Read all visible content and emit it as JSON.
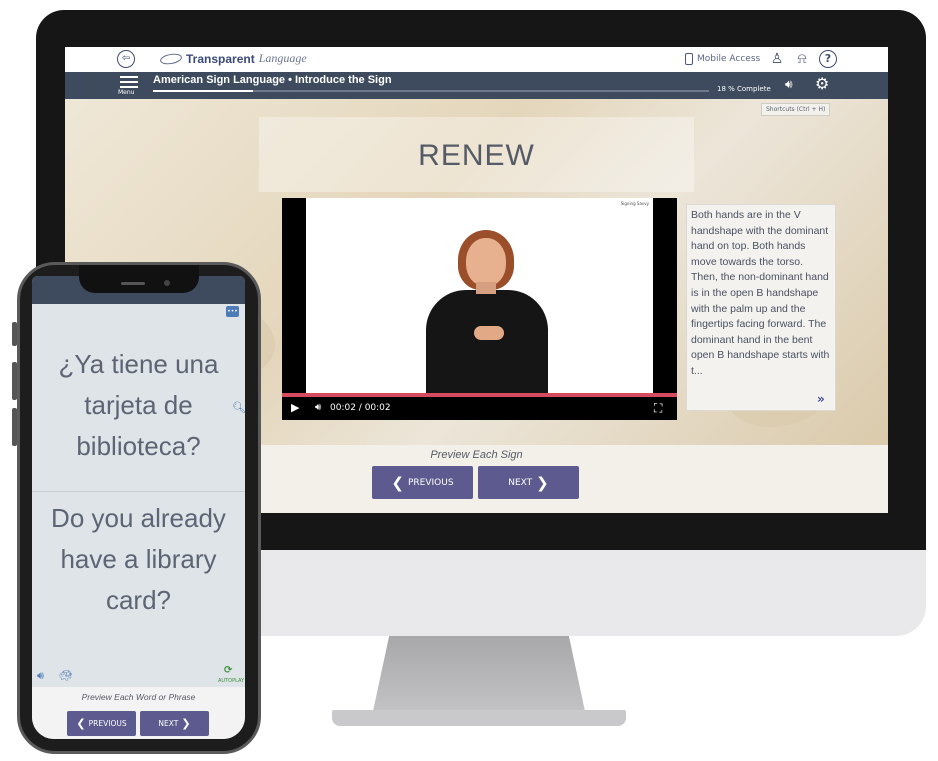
{
  "app": {
    "logo_strong": "Transparent",
    "logo_italic": "Language",
    "mobile_access": "Mobile Access",
    "menu_label": "Menu",
    "lesson_title": "American Sign Language • Introduce the Sign",
    "progress_percent": 18,
    "progress_text": "18 % Complete",
    "shortcuts": "Shortcuts (Ctrl + H)"
  },
  "lesson": {
    "word": "RENEW",
    "video_time": "00:02 / 00:02",
    "watermark": "Signing Savvy",
    "description": "Both hands are in the V handshape with the dominant hand on top. Both hands move towards the torso. Then, the non-dominant hand is in the open B handshape with the palm up and the fingertips facing forward. The dominant hand in the bent open B handshape starts with t...",
    "preview_label": "Preview Each Sign",
    "prev_label": "PREVIOUS",
    "next_label": "NEXT"
  },
  "phone": {
    "spanish_phrase": "¿Ya tiene una tarjeta de biblioteca?",
    "english_phrase": "Do you already have a library card?",
    "autoplay_label": "AUTOPLAY",
    "preview_label": "Preview Each Word or Phrase",
    "prev_label": "PREVIOUS",
    "next_label": "NEXT"
  },
  "icons": {
    "back": "back-arrow-icon",
    "mobile": "mobile-phone-icon",
    "user": "user-icon",
    "notifications": "bell-icon",
    "help": "help-icon",
    "settings": "gear-icon",
    "audio": "speaker-icon"
  },
  "colors": {
    "nav_bar": "#3e4b5e",
    "button": "#5c5a8e",
    "progress": "#d64b5f",
    "link_accent": "#4d7cb7"
  }
}
